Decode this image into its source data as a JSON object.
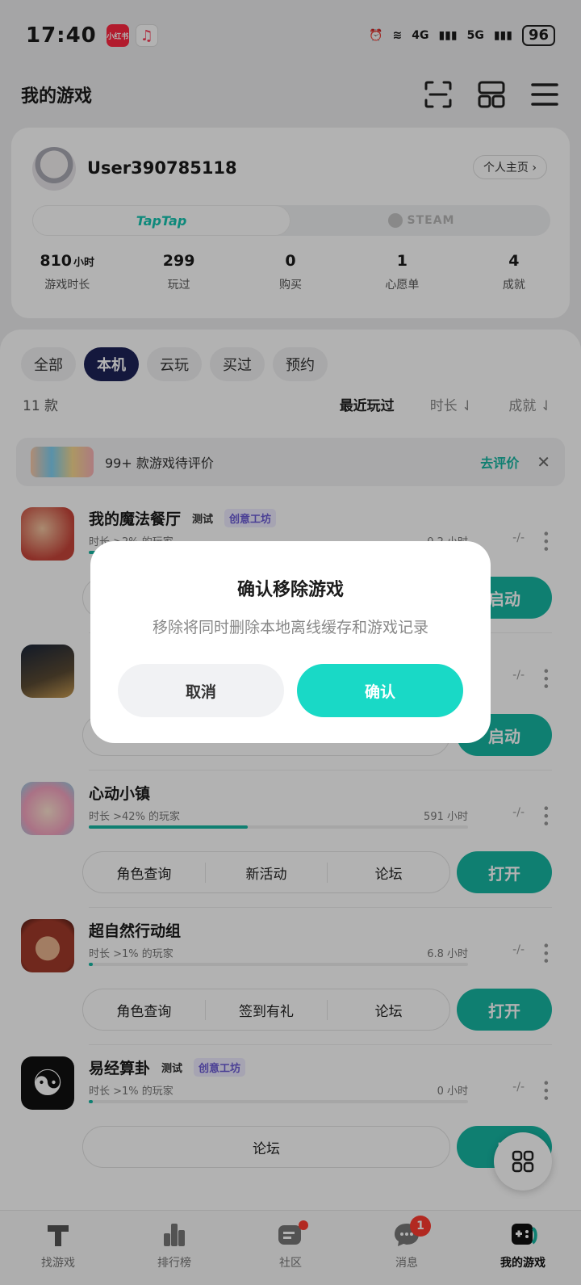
{
  "status": {
    "time": "17:40",
    "badge1": "小红书",
    "signal1": "4G",
    "signal2": "5G",
    "battery": "96"
  },
  "header": {
    "title": "我的游戏"
  },
  "profile": {
    "username": "User390785118",
    "home_link": "个人主页 ›",
    "platform_tap": "TapTap",
    "platform_steam": "STEAM",
    "stats": [
      {
        "value": "810",
        "unit": "小时",
        "label": "游戏时长"
      },
      {
        "value": "299",
        "unit": "",
        "label": "玩过"
      },
      {
        "value": "0",
        "unit": "",
        "label": "购买"
      },
      {
        "value": "1",
        "unit": "",
        "label": "心愿单"
      },
      {
        "value": "4",
        "unit": "",
        "label": "成就"
      }
    ]
  },
  "filters": [
    "全部",
    "本机",
    "云玩",
    "买过",
    "预约"
  ],
  "list": {
    "count": "11 款",
    "sort_recent": "最近玩过",
    "sort_duration": "时长 ⇃",
    "sort_achievement": "成就 ⇃"
  },
  "review_banner": {
    "text": "99+ 款游戏待评价",
    "action": "去评价",
    "close": "✕"
  },
  "games": [
    {
      "name": "我的魔法餐厅",
      "tag_test": "测试",
      "tag_creative": "创意工坊",
      "meta": "时长 >2% 的玩家",
      "hours": "0.2 小时",
      "progress": 0.02,
      "rating": "-/-",
      "actions": [],
      "button": "启动",
      "icon_color": "#c8453a"
    },
    {
      "name": "",
      "tag_test": "",
      "tag_creative": "",
      "meta": "",
      "hours": "",
      "progress": 0.0,
      "rating": "-/-",
      "actions": [],
      "button": "启动",
      "icon_color": "#30415a"
    },
    {
      "name": "心动小镇",
      "tag_test": "",
      "tag_creative": "",
      "meta": "时长 >42% 的玩家",
      "hours": "591 小时",
      "progress": 0.42,
      "rating": "-/-",
      "actions": [
        "角色查询",
        "新活动",
        "论坛"
      ],
      "button": "打开",
      "icon_color": "#f4a3c0"
    },
    {
      "name": "超自然行动组",
      "tag_test": "",
      "tag_creative": "",
      "meta": "时长 >1% 的玩家",
      "hours": "6.8 小时",
      "progress": 0.01,
      "rating": "-/-",
      "actions": [
        "角色查询",
        "签到有礼",
        "论坛"
      ],
      "button": "打开",
      "icon_color": "#a13a2a"
    },
    {
      "name": "易经算卦",
      "tag_test": "测试",
      "tag_creative": "创意工坊",
      "meta": "时长 >1% 的玩家",
      "hours": "0 小时",
      "progress": 0.01,
      "rating": "-/-",
      "actions": [
        "论坛"
      ],
      "button": "启",
      "icon_color": "#111111"
    }
  ],
  "bottom_nav": [
    {
      "label": "找游戏"
    },
    {
      "label": "排行榜"
    },
    {
      "label": "社区"
    },
    {
      "label": "消息",
      "badge": "1"
    },
    {
      "label": "我的游戏"
    }
  ],
  "dialog": {
    "title": "确认移除游戏",
    "message": "移除将同时删除本地离线缓存和游戏记录",
    "cancel": "取消",
    "confirm": "确认"
  },
  "colors": {
    "accent": "#16b6a3",
    "confirm": "#19d9c6",
    "chip_active": "#1e2358"
  }
}
